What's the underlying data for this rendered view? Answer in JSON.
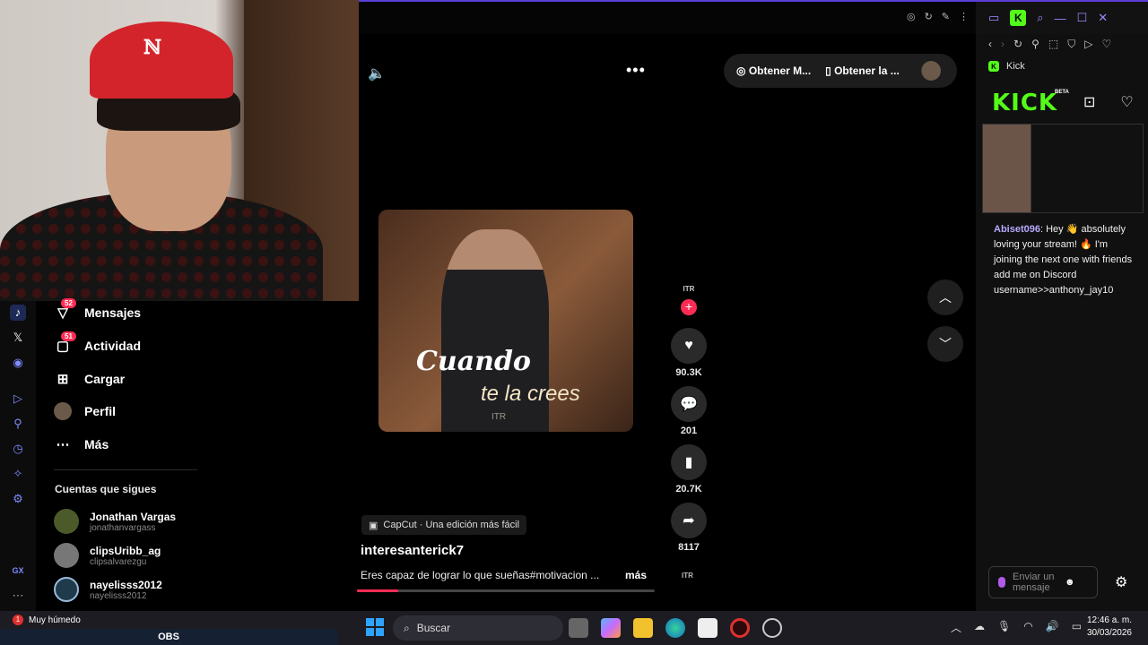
{
  "colors": {
    "accent": "#fe2c55",
    "kick_green": "#53fc18",
    "chat_user": "#b7a9ff"
  },
  "kick_tab": {
    "label": "Kick"
  },
  "sidebar": {
    "items": [
      {
        "label": "Mensajes",
        "icon": "messages-icon",
        "badge": "52"
      },
      {
        "label": "Actividad",
        "icon": "activity-icon",
        "badge": "51"
      },
      {
        "label": "Cargar",
        "icon": "upload-icon"
      },
      {
        "label": "Perfil",
        "icon": "avatar"
      },
      {
        "label": "Más",
        "icon": "more-icon"
      }
    ],
    "following_title": "Cuentas que sigues",
    "following": [
      {
        "name": "Jonathan Vargas",
        "handle": "jonathanvargass"
      },
      {
        "name": "clipsUribb_ag",
        "handle": "clipsalvarezgu"
      },
      {
        "name": "nayelisss2012",
        "handle": "nayelisss2012"
      }
    ]
  },
  "rail": {
    "bottom_label": "GX"
  },
  "top_pill": {
    "get_app": "Obtener M...",
    "get_app2": "Obtener la ..."
  },
  "video": {
    "caption_line1": "Cuando",
    "caption_line2": "te la crees",
    "watermark": "ITR",
    "creator_logo": "ITR",
    "likes": "90.3K",
    "comments": "201",
    "saves": "20.7K",
    "shares": "8117",
    "capcut": "CapCut · Una edición más fácil",
    "author": "interesanterick7",
    "description": "Eres capaz de lograr lo que sueñas#motivacion ...",
    "more": "más",
    "progress": 0.14
  },
  "kick": {
    "logo": "KICK",
    "beta": "BETA",
    "chat": {
      "user": "Abiset096",
      "message": ": Hey 👋 absolutely loving your stream! 🔥 I'm joining the next one with friends add me on Discord username>>anthony_jay10"
    },
    "input_placeholder": "Enviar un mensaje"
  },
  "taskbar": {
    "weather": "Muy húmedo",
    "weather_badge": "1",
    "obs": "OBS",
    "search": "Buscar",
    "time": "12:46 a. m.",
    "date": "30/03/2026"
  }
}
